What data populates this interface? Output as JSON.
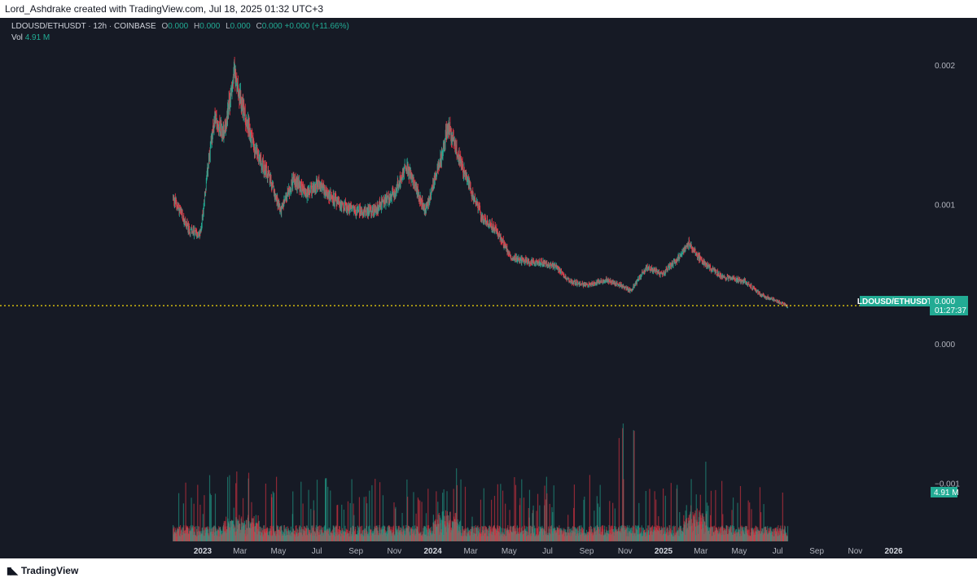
{
  "header": {
    "credit": "Lord_Ashdrake created with TradingView.com, Jul 18, 2025 01:32 UTC+3"
  },
  "legend": {
    "symbol": "LDOUSD/ETHUSDT",
    "interval": "12h",
    "exchange": "COINBASE",
    "o_label": "O",
    "o_value": "0.000",
    "h_label": "H",
    "h_value": "0.000",
    "l_label": "L",
    "l_value": "0.000",
    "c_label": "C",
    "c_value": "0.000",
    "change": "+0.000 (+11.66%)",
    "vol_label": "Vol",
    "vol_value": "4.91 M"
  },
  "price_tag": {
    "symbol": "LDOUSD/ETHUSDT",
    "value": "0.000",
    "countdown": "01:27:37"
  },
  "vol_tag": "4.91 M",
  "brand": "TradingView",
  "colors": {
    "background": "#161a25",
    "up": "#22ab94",
    "down": "#f23645",
    "price_line": "#f5d90a"
  },
  "chart_data": {
    "type": "candlestick",
    "y_ticks": [
      "0.002",
      "0.001",
      "0.000",
      "−0.001"
    ],
    "x_ticks": [
      "2023",
      "Mar",
      "May",
      "Jul",
      "Sep",
      "Nov",
      "2024",
      "Mar",
      "May",
      "Jul",
      "Sep",
      "Nov",
      "2025",
      "Mar",
      "May",
      "Jul",
      "Sep",
      "Nov",
      "2026"
    ],
    "close_path": [
      [
        "2022-11-15",
        0.00105
      ],
      [
        "2022-12-10",
        0.00082
      ],
      [
        "2022-12-28",
        0.00078
      ],
      [
        "2023-01-10",
        0.00128
      ],
      [
        "2023-01-20",
        0.00162
      ],
      [
        "2023-02-05",
        0.00152
      ],
      [
        "2023-02-20",
        0.00195
      ],
      [
        "2023-03-05",
        0.0017
      ],
      [
        "2023-03-25",
        0.0014
      ],
      [
        "2023-04-20",
        0.00115
      ],
      [
        "2023-05-05",
        0.00095
      ],
      [
        "2023-05-25",
        0.00118
      ],
      [
        "2023-06-15",
        0.00108
      ],
      [
        "2023-07-05",
        0.00115
      ],
      [
        "2023-08-05",
        0.001
      ],
      [
        "2023-09-05",
        0.00095
      ],
      [
        "2023-10-01",
        0.00096
      ],
      [
        "2023-11-01",
        0.00108
      ],
      [
        "2023-11-20",
        0.00128
      ],
      [
        "2023-12-20",
        0.00095
      ],
      [
        "2024-01-15",
        0.00135
      ],
      [
        "2024-01-25",
        0.00158
      ],
      [
        "2024-02-20",
        0.00122
      ],
      [
        "2024-03-20",
        0.0009
      ],
      [
        "2024-04-10",
        0.00082
      ],
      [
        "2024-05-05",
        0.00062
      ],
      [
        "2024-05-20",
        0.0006
      ],
      [
        "2024-06-25",
        0.00058
      ],
      [
        "2024-07-15",
        0.00055
      ],
      [
        "2024-08-05",
        0.00045
      ],
      [
        "2024-09-01",
        0.00042
      ],
      [
        "2024-10-01",
        0.00046
      ],
      [
        "2024-10-25",
        0.00042
      ],
      [
        "2024-11-10",
        0.00038
      ],
      [
        "2024-12-05",
        0.00055
      ],
      [
        "2024-12-30",
        0.0005
      ],
      [
        "2025-01-25",
        0.00062
      ],
      [
        "2025-02-10",
        0.00072
      ],
      [
        "2025-03-05",
        0.00058
      ],
      [
        "2025-04-05",
        0.00048
      ],
      [
        "2025-05-10",
        0.00045
      ],
      [
        "2025-06-05",
        0.00035
      ],
      [
        "2025-07-10",
        0.00029
      ],
      [
        "2025-07-17",
        0.00027
      ]
    ],
    "volume_units": "M",
    "last_volume": 4.91,
    "grid": false
  }
}
